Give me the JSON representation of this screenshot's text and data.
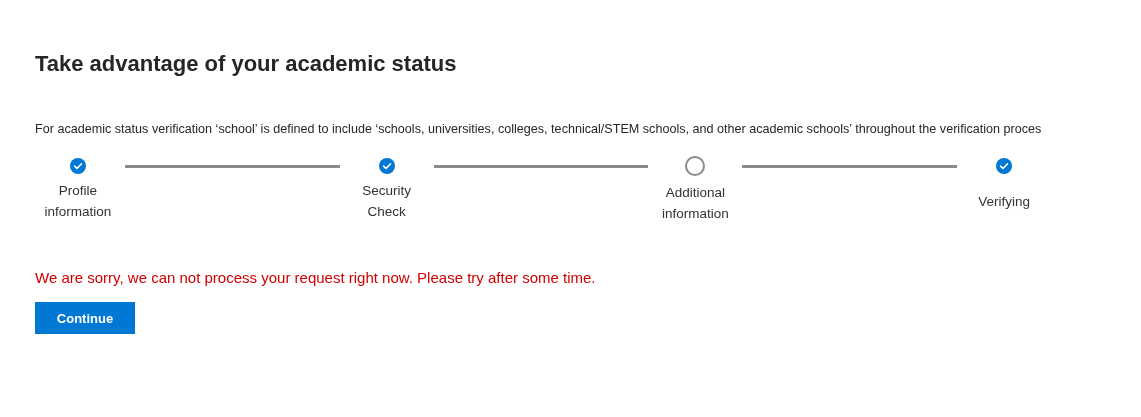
{
  "heading": "Take advantage of your academic status",
  "intro": "For academic status verification ‘school’ is defined to include ‘schools, universities, colleges, technical/STEM schools, and other academic schools’ throughout the verification proces",
  "steps": [
    {
      "label": "Profile information",
      "completed": true
    },
    {
      "label": "Security Check",
      "completed": true
    },
    {
      "label": "Additional information",
      "completed": false
    },
    {
      "label": "Verifying",
      "completed": true
    }
  ],
  "error_message": "We are sorry, we can not process your request right now. Please try after some time.",
  "buttons": [
    {
      "label": "Continue",
      "kind": "primary"
    }
  ]
}
